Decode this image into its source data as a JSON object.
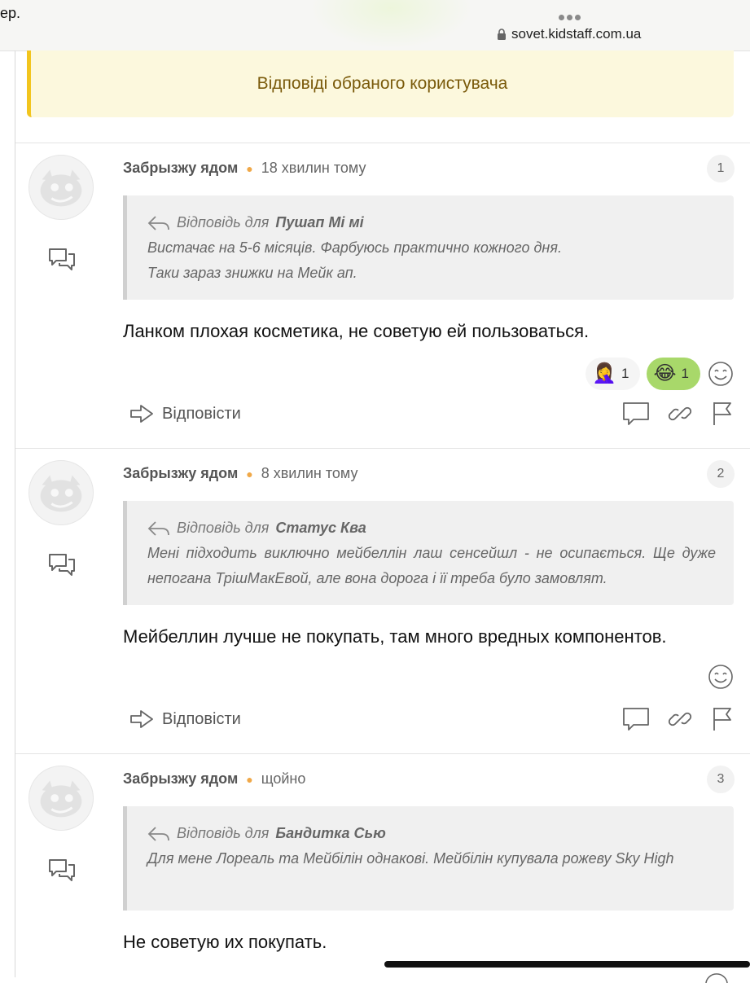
{
  "browser": {
    "left_fragment": "ер.",
    "url": "sovet.kidstaff.com.ua"
  },
  "notice": {
    "text": "Відповіді обраного користувача"
  },
  "posts": [
    {
      "author": "Забрызжу ядом",
      "time": "18 хвилин тому",
      "number": "1",
      "quote": {
        "prefix": "Відповідь для",
        "to": "Пушап Мі мі",
        "lines": [
          "Вистачає на 5-6 місяців. Фарбуюсь практично кожного дня.",
          "Таки зараз знижки на Мейк ап."
        ]
      },
      "text": "Ланком плохая косметика, не советую ей пользоваться.",
      "reactions": [
        {
          "emoji": "🤦‍♀️",
          "count": "1",
          "active": false
        },
        {
          "emoji": "😂",
          "count": "1",
          "active": true
        }
      ],
      "reply_label": "Відповісти"
    },
    {
      "author": "Забрызжу ядом",
      "time": "8 хвилин тому",
      "number": "2",
      "quote": {
        "prefix": "Відповідь для",
        "to": "Статус Ква",
        "lines": [
          "Мені підходить виключно мейбеллін лаш сенсейшл - не осипається. Ще дуже непогана ТрішМакЕвой, але вона дорога і її треба було замовлят."
        ]
      },
      "text": "Мейбеллин лучше не покупать, там много вредных компонентов.",
      "reactions": [],
      "reply_label": "Відповісти"
    },
    {
      "author": "Забрызжу ядом",
      "time": "щойно",
      "number": "3",
      "quote": {
        "prefix": "Відповідь для",
        "to": "Бандитка Сью",
        "lines": [
          "Для мене Лореаль та Мейбілін однакові. Мейбілін купувала рожеву Sky High"
        ]
      },
      "text": "Не советую их покупать.",
      "reactions": [],
      "reply_label": "Відповісти"
    }
  ]
}
